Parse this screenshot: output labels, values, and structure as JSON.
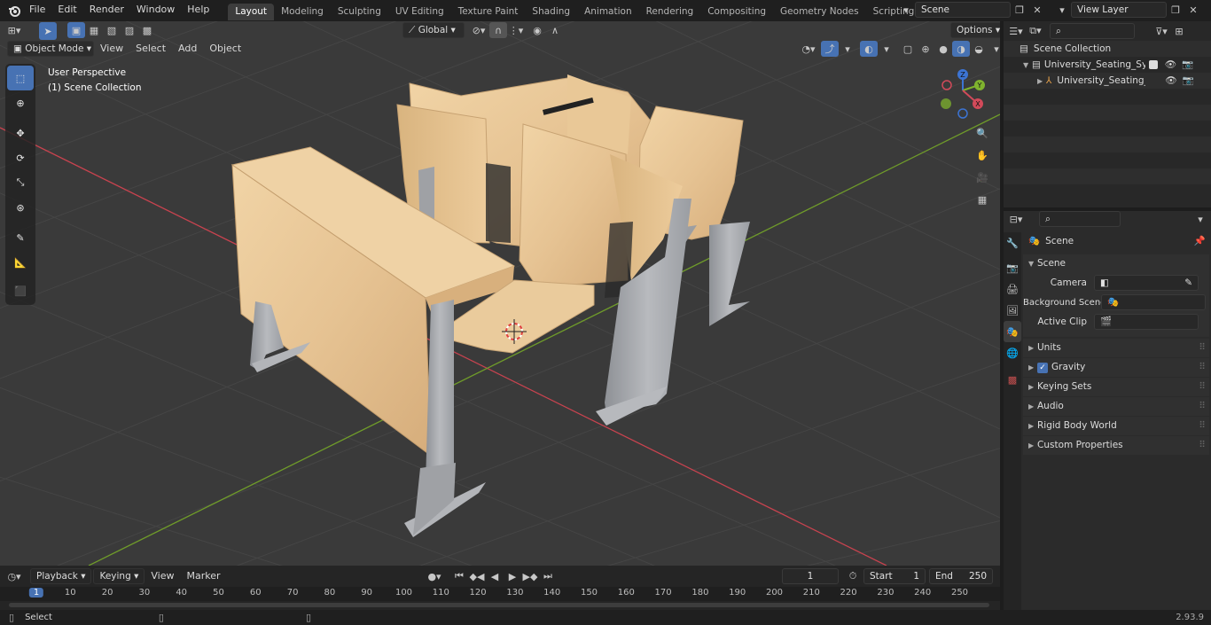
{
  "menu": {
    "file": "File",
    "edit": "Edit",
    "render": "Render",
    "window": "Window",
    "help": "Help"
  },
  "workspaces": [
    "Layout",
    "Modeling",
    "Sculpting",
    "UV Editing",
    "Texture Paint",
    "Shading",
    "Animation",
    "Rendering",
    "Compositing",
    "Geometry Nodes",
    "Scripting"
  ],
  "active_workspace": "Layout",
  "scene_field": "Scene",
  "view_layer_field": "View Layer",
  "viewport": {
    "mode": "Object Mode",
    "menus": {
      "view": "View",
      "select": "Select",
      "add": "Add",
      "object": "Object"
    },
    "transform_orientation": "Global",
    "options": "Options",
    "overlay_title": "User Perspective",
    "overlay_subtitle": "(1) Scene Collection",
    "gizmo": {
      "x": "X",
      "y": "Y",
      "z": "Z"
    }
  },
  "outliner": {
    "root": "Scene Collection",
    "collection": "University_Seating_System_S",
    "object": "University_Seating_Syste"
  },
  "properties": {
    "context": "Scene",
    "section": "Scene",
    "camera_label": "Camera",
    "background_label": "Background Scene",
    "active_clip_label": "Active Clip",
    "panels": {
      "units": "Units",
      "gravity": "Gravity",
      "keying": "Keying Sets",
      "audio": "Audio",
      "rigid": "Rigid Body World",
      "custom": "Custom Properties"
    }
  },
  "timeline": {
    "playback": "Playback",
    "keying": "Keying",
    "view": "View",
    "marker": "Marker",
    "current_frame": "1",
    "start_label": "Start",
    "start": "1",
    "end_label": "End",
    "end": "250",
    "ruler": [
      "1",
      "10",
      "20",
      "30",
      "40",
      "50",
      "60",
      "70",
      "80",
      "90",
      "100",
      "110",
      "120",
      "130",
      "140",
      "150",
      "160",
      "170",
      "180",
      "190",
      "200",
      "210",
      "220",
      "230",
      "240",
      "250"
    ]
  },
  "status": {
    "select": "Select",
    "version": "2.93.9"
  },
  "colors": {
    "accent": "#4772b3",
    "axis_x": "#c8434f",
    "axis_y": "#6f9b2a",
    "wood": "#e7c596",
    "metal": "#a9abaf"
  }
}
